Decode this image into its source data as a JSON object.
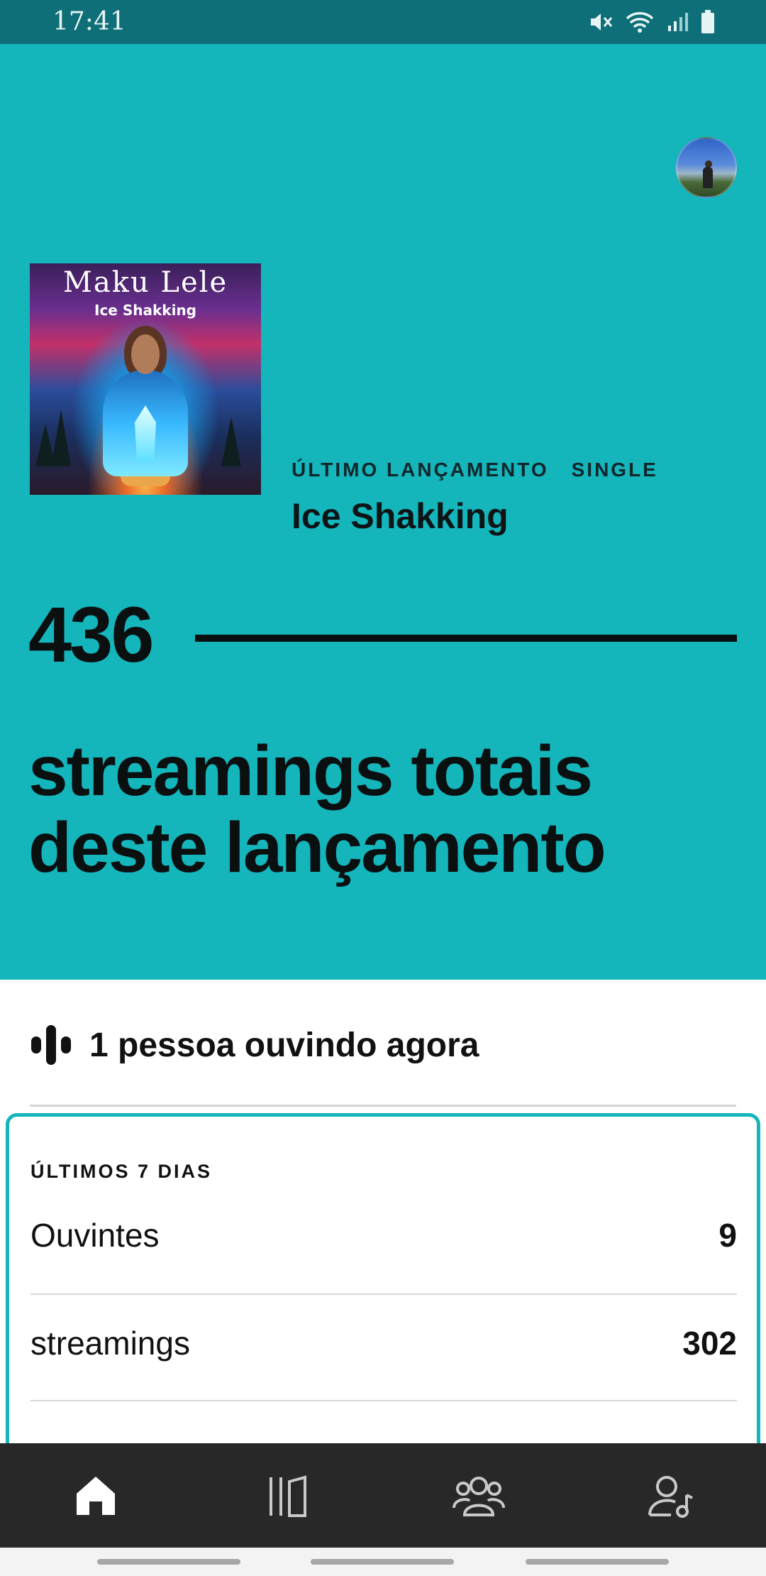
{
  "status_bar": {
    "time": "17:41",
    "icons": [
      "mute-icon",
      "wifi-icon",
      "signal-icon",
      "battery-icon"
    ]
  },
  "hero": {
    "background_color": "#14b5bb",
    "cover_art": {
      "title": "Maku Lele",
      "subtitle": "Ice Shakking"
    },
    "release_label": "ÚLTIMO LANÇAMENTO",
    "release_type": "SINGLE",
    "release_title": "Ice Shakking",
    "total_streams": "436",
    "total_streams_caption": "streamings totais deste lançamento"
  },
  "live": {
    "icon": "listening-bars-icon",
    "text": "1 pessoa ouvindo agora"
  },
  "last7": {
    "heading": "ÚLTIMOS 7 DIAS",
    "accent_color": "#14b5bb",
    "rows": [
      {
        "label": "Ouvintes",
        "value": "9"
      },
      {
        "label": "streamings",
        "value": "302"
      }
    ]
  },
  "bottom_nav": {
    "items": [
      {
        "icon": "home-icon",
        "active": true
      },
      {
        "icon": "catalog-icon",
        "active": false
      },
      {
        "icon": "audience-icon",
        "active": false
      },
      {
        "icon": "artist-profile-icon",
        "active": false
      }
    ]
  }
}
